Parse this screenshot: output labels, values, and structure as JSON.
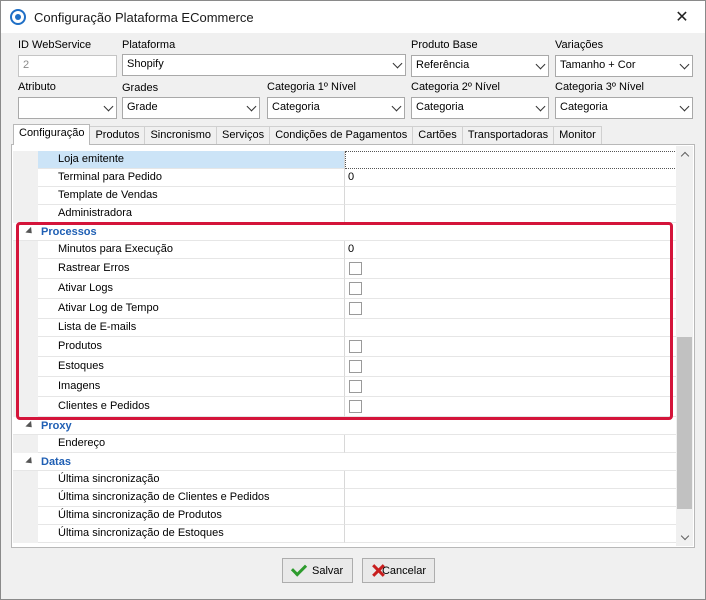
{
  "window": {
    "title": "Configuração Plataforma ECommerce",
    "close_glyph": "✕"
  },
  "top_form": {
    "id_webservice": {
      "label": "ID WebService",
      "value": "2"
    },
    "plataforma": {
      "label": "Plataforma",
      "value": "Shopify"
    },
    "produto_base": {
      "label": "Produto Base",
      "value": "Referência"
    },
    "variacoes": {
      "label": "Variações",
      "value": "Tamanho + Cor"
    },
    "atributo": {
      "label": "Atributo",
      "value": ""
    },
    "grades": {
      "label": "Grades",
      "value": "Grade"
    },
    "categoria1": {
      "label": "Categoria 1º Nível",
      "value": "Categoria"
    },
    "categoria2": {
      "label": "Categoria 2º Nível",
      "value": "Categoria"
    },
    "categoria3": {
      "label": "Categoria 3º Nível",
      "value": "Categoria"
    }
  },
  "tabs": [
    {
      "label": "Configuração",
      "active": true
    },
    {
      "label": "Produtos"
    },
    {
      "label": "Sincronismo"
    },
    {
      "label": "Serviços"
    },
    {
      "label": "Condições de Pagamentos"
    },
    {
      "label": "Cartões"
    },
    {
      "label": "Transportadoras"
    },
    {
      "label": "Monitor"
    }
  ],
  "grid": {
    "general": [
      {
        "name": "Loja emitente",
        "value": "",
        "selected": true
      },
      {
        "name": "Terminal para Pedido",
        "value": "0"
      },
      {
        "name": "Template de Vendas",
        "value": ""
      },
      {
        "name": "Administradora",
        "value": ""
      }
    ],
    "processos": {
      "label": "Processos",
      "rows": [
        {
          "name": "Minutos para Execução",
          "value": "0"
        },
        {
          "name": "Rastrear Erros",
          "checked": false
        },
        {
          "name": "Ativar Logs",
          "checked": false
        },
        {
          "name": "Ativar Log de Tempo",
          "checked": false
        },
        {
          "name": "Lista de E-mails",
          "value": ""
        },
        {
          "name": "Produtos",
          "checked": false
        },
        {
          "name": "Estoques",
          "checked": false
        },
        {
          "name": "Imagens",
          "checked": false
        },
        {
          "name": "Clientes e Pedidos",
          "checked": false
        }
      ]
    },
    "proxy": {
      "label": "Proxy",
      "rows": [
        {
          "name": "Endereço",
          "value": ""
        }
      ]
    },
    "datas": {
      "label": "Datas",
      "rows": [
        {
          "name": "Última sincronização",
          "value": ""
        },
        {
          "name": "Última sincronização de Clientes e Pedidos",
          "value": ""
        },
        {
          "name": "Última sincronização de Produtos",
          "value": ""
        },
        {
          "name": "Última sincronização de Estoques",
          "value": ""
        }
      ]
    }
  },
  "buttons": {
    "save": "Salvar",
    "cancel": "Cancelar"
  },
  "colors": {
    "highlight": "#d4143a",
    "category_text": "#1f5fb4",
    "selected_row": "#cce4f7"
  },
  "icons": {
    "save": "checkmark-icon",
    "cancel": "x-icon"
  }
}
